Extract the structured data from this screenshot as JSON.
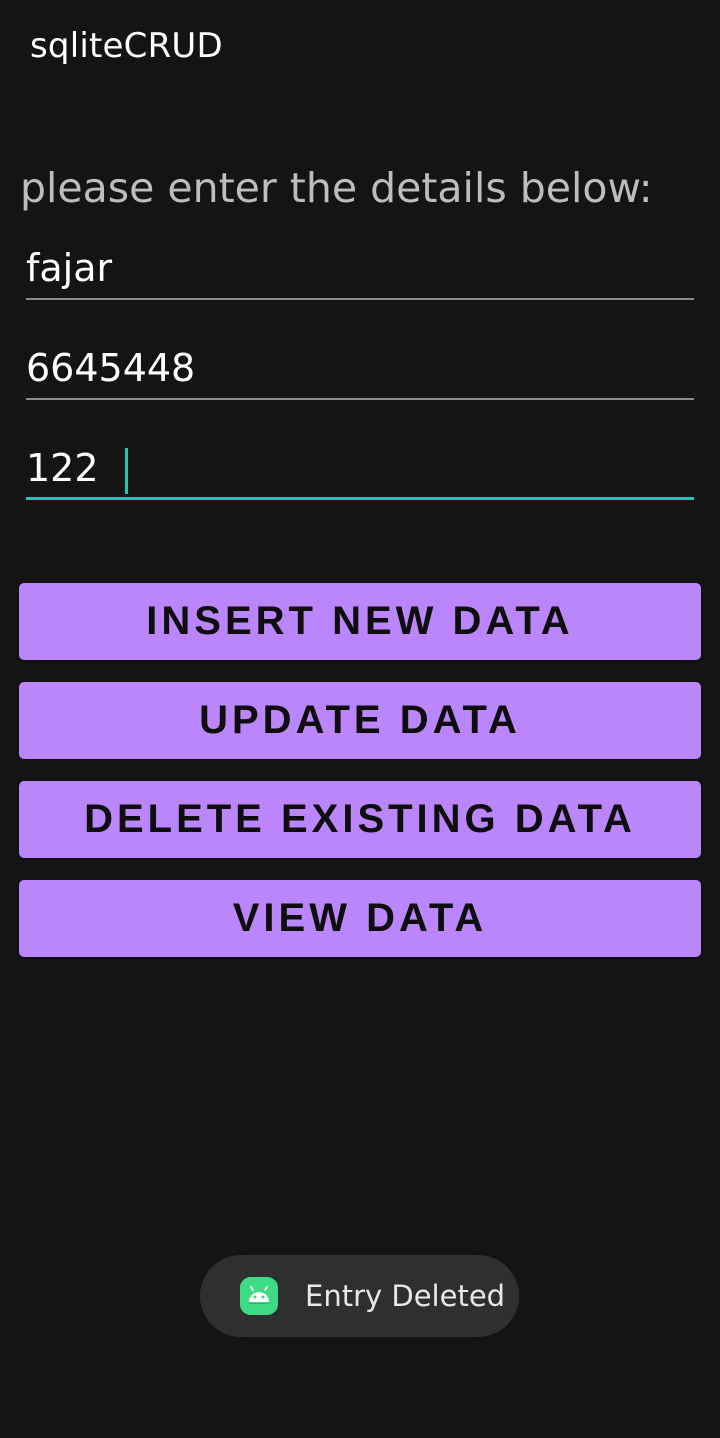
{
  "app": {
    "title": "sqliteCRUD"
  },
  "form": {
    "prompt": "please enter the details below:",
    "fields": [
      {
        "value": "fajar",
        "focused": false
      },
      {
        "value": "6645448",
        "focused": false
      },
      {
        "value": "122",
        "focused": true
      }
    ]
  },
  "buttons": {
    "insert": "INSERT NEW DATA",
    "update": "UPDATE DATA",
    "delete": "DELETE EXISTING DATA",
    "view": "VIEW DATA"
  },
  "toast": {
    "icon": "android-icon",
    "message": "Entry Deleted"
  },
  "colors": {
    "background": "#141414",
    "button": "#bb86fc",
    "accent": "#1fc6b5",
    "toast_background": "#2f2f2f",
    "android_green": "#3ddc84"
  }
}
